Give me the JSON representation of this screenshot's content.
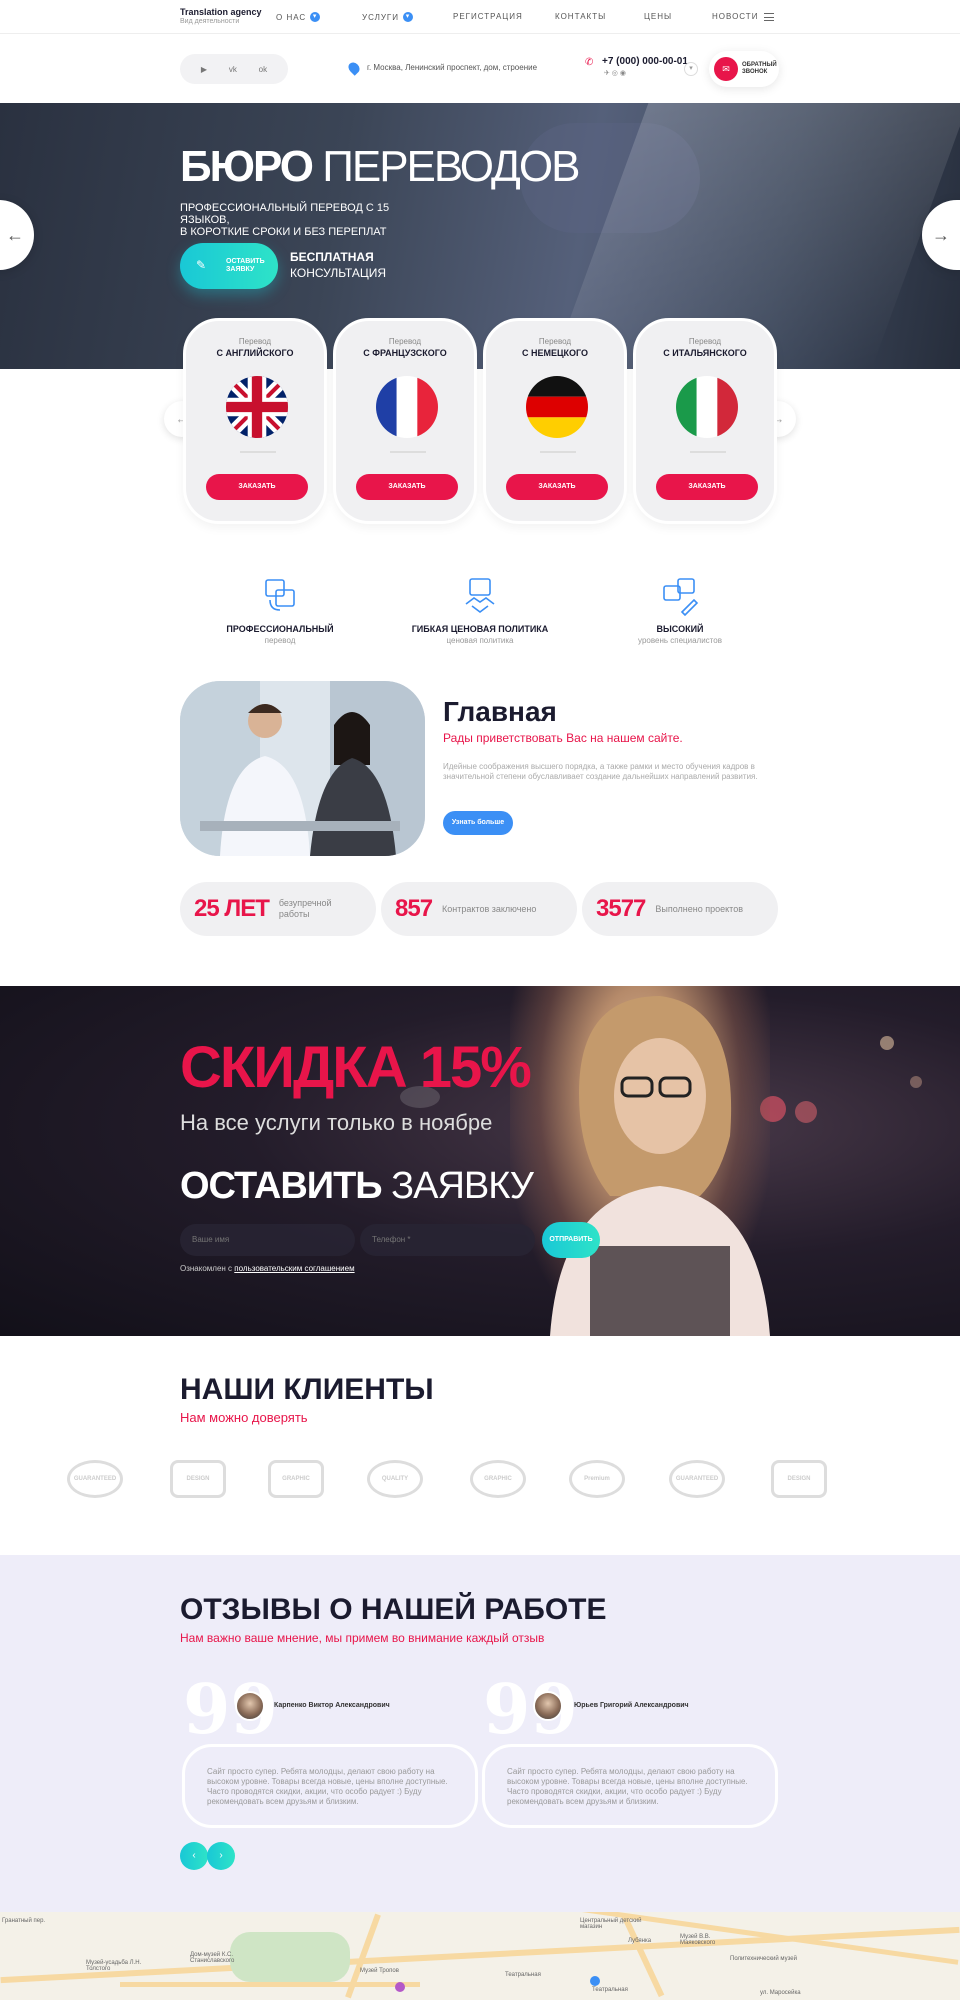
{
  "nav": {
    "brand": "Translation agency",
    "brand_sub": "Вид деятельности",
    "items": [
      {
        "label": "О НАС",
        "has_dropdown": true
      },
      {
        "label": "УСЛУГИ",
        "has_dropdown": true
      },
      {
        "label": "РЕГИСТРАЦИЯ",
        "has_dropdown": false
      },
      {
        "label": "КОНТАКТЫ",
        "has_dropdown": false
      },
      {
        "label": "ЦЕНЫ",
        "has_dropdown": false
      },
      {
        "label": "НОВОСТИ",
        "has_dropdown": false
      }
    ]
  },
  "contacts": {
    "socials": [
      "youtube-icon",
      "vk-icon",
      "odnoklassniki-icon"
    ],
    "address": "г. Москва, Ленинский проспект, дом, строение",
    "phone": "+7 (000) 000-00-01",
    "callback_label": "ОБРАТНЫЙ ЗВОНОК"
  },
  "hero": {
    "title_bold": "БЮРО",
    "title_thin": "ПЕРЕВОДОВ",
    "subtitle_line1": "ПРОФЕССИОНАЛЬНЫЙ ПЕРЕВОД С 15 ЯЗЫКОВ,",
    "subtitle_line2": "В КОРОТКИЕ СРОКИ И БЕЗ ПЕРЕПЛАТ",
    "btn_line1": "ОСТАВИТЬ",
    "btn_line2": "ЗАЯВКУ",
    "consult_line1": "БЕСПЛАТНАЯ",
    "consult_line2": "КОНСУЛЬТАЦИЯ"
  },
  "languages": [
    {
      "pre": "Перевод",
      "label": "С АНГЛИЙСКОГО",
      "order": "ЗАКАЗАТЬ"
    },
    {
      "pre": "Перевод",
      "label": "С ФРАНЦУЗСКОГО",
      "order": "ЗАКАЗАТЬ"
    },
    {
      "pre": "Перевод",
      "label": "С НЕМЕЦКОГО",
      "order": "ЗАКАЗАТЬ"
    },
    {
      "pre": "Перевод",
      "label": "С ИТАЛЬЯНСКОГО",
      "order": "ЗАКАЗАТЬ"
    }
  ],
  "features": [
    {
      "title": "ПРОФЕССИОНАЛЬНЫЙ",
      "sub": "перевод"
    },
    {
      "title": "ГИБКАЯ ЦЕНОВАЯ ПОЛИТИКА",
      "sub": "ценовая политика"
    },
    {
      "title": "ВЫСОКИЙ",
      "sub": "уровень специалистов"
    }
  ],
  "about": {
    "title": "Главная",
    "subtitle": "Рады приветствовать Вас на нашем сайте.",
    "text": "Идейные соображения высшего порядка, а также рамки и место обучения кадров в значительной степени обуславливает создание дальнейших направлений развития.",
    "button": "Узнать больше"
  },
  "stats": [
    {
      "number": "25 ЛЕТ",
      "label_1": "безупречной",
      "label_2": "работы"
    },
    {
      "number": "857",
      "label_1": "Контрактов заключено",
      "label_2": ""
    },
    {
      "number": "3577",
      "label_1": "Выполнено проектов",
      "label_2": ""
    }
  ],
  "promo": {
    "title": "СКИДКА 15%",
    "subtitle": "На все услуги только в ноябре",
    "form_bold": "ОСТАВИТЬ",
    "form_thin": "ЗАЯВКУ",
    "name_placeholder": "Ваше имя",
    "phone_placeholder": "Телефон *",
    "send": "ОТПРАВИТЬ",
    "agree_prefix": "Ознакомлен с",
    "agree_link": "пользовательским соглашением"
  },
  "clients": {
    "title": "НАШИ КЛИЕНТЫ",
    "subtitle": "Нам можно доверять"
  },
  "reviews": {
    "title": "ОТЗЫВЫ О НАШЕЙ РАБОТЕ",
    "subtitle": "Нам важно ваше мнение, мы примем во внимание каждый отзыв",
    "items": [
      {
        "name": "Карпенко Виктор Александрович",
        "text": "Сайт просто супер. Ребята молодцы, делают свою работу на высоком уровне. Товары всегда новые, цены вполне доступные. Часто проводятся скидки, акции, что особо радует :) Буду рекомендовать всем друзьям и близким."
      },
      {
        "name": "Юрьев Григорий Александрович",
        "text": "Сайт просто супер. Ребята молодцы, делают свою работу на высоком уровне. Товары всегда новые, цены вполне доступные. Часто проводятся скидки, акции, что особо радует :) Буду рекомендовать всем друзьям и близким."
      }
    ]
  },
  "map": {
    "labels": [
      "Гранатный пер.",
      "Музей-усадьба Л.Н. Толстого",
      "Дом-музей К.С. Станиславского",
      "Центральный детский магазин",
      "Музей В.В. Маяковского",
      "Лубянка",
      "Политехнический музей",
      "Театральная",
      "Музей Тропов",
      "ул. Маросейка",
      "Театральная"
    ]
  },
  "colors": {
    "accent": "#e8154a",
    "teal": "#19c8d6",
    "blue": "#3b8ff5",
    "reviews_bg": "#eeedf9"
  }
}
